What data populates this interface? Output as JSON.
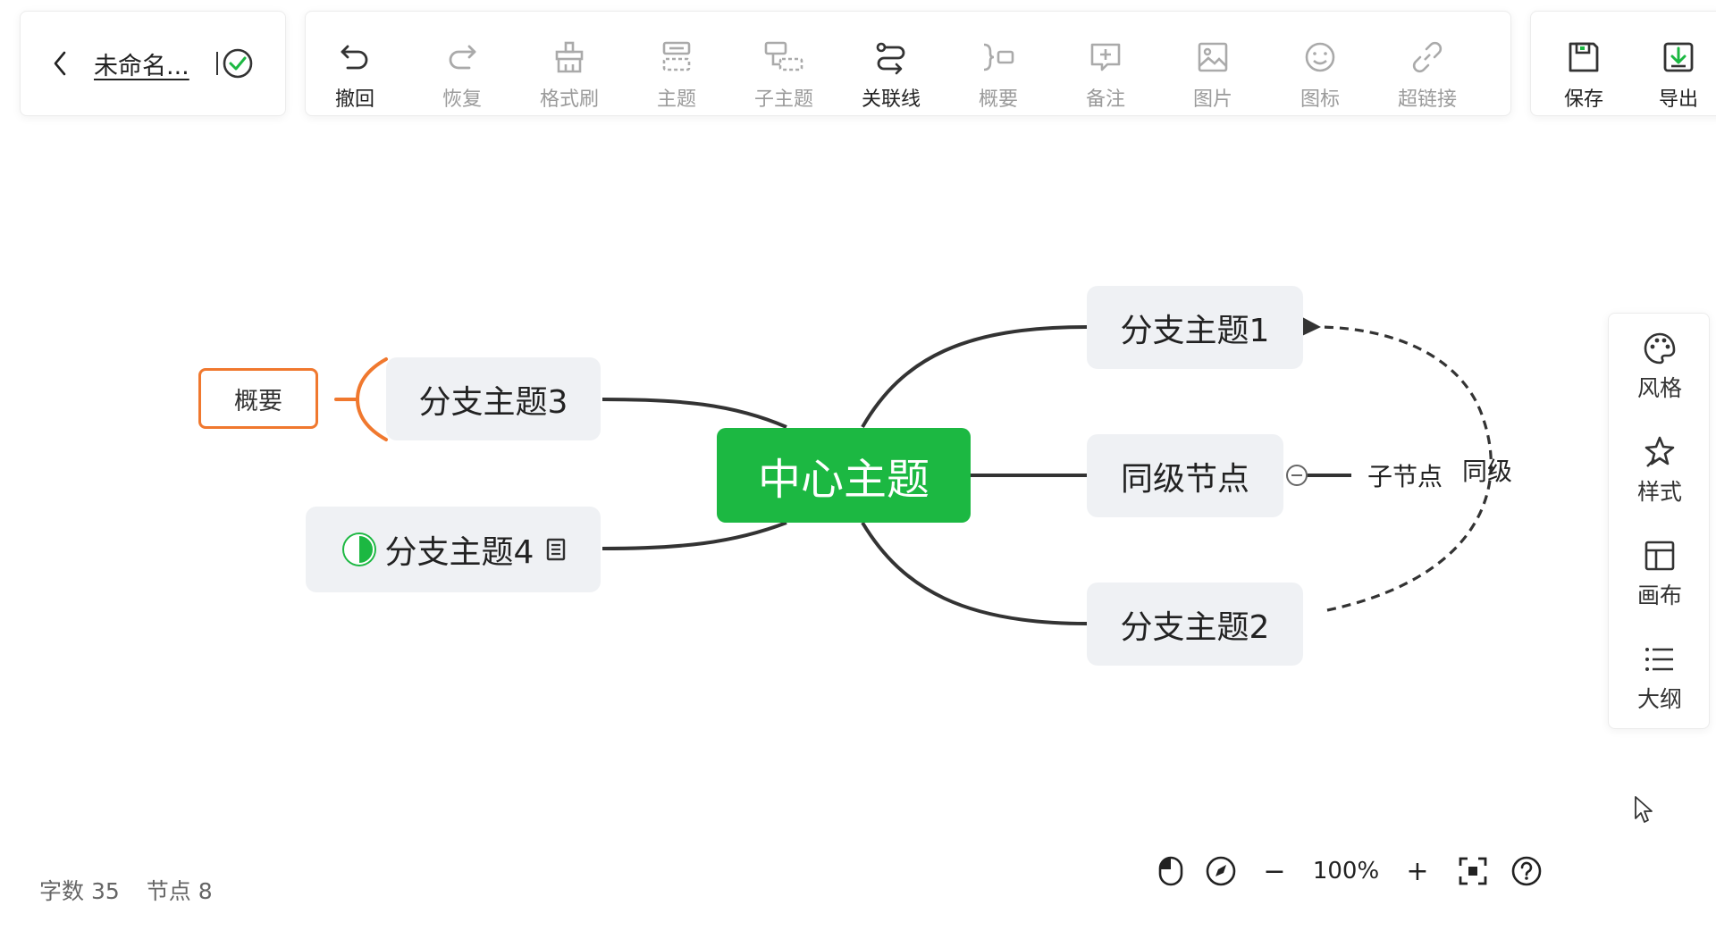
{
  "document": {
    "title": "未命名..."
  },
  "toolbar": {
    "tools": [
      {
        "label": "撤回",
        "icon": "undo-icon",
        "enabled": true
      },
      {
        "label": "恢复",
        "icon": "redo-icon",
        "enabled": false
      },
      {
        "label": "格式刷",
        "icon": "format-painter-icon",
        "enabled": false
      },
      {
        "label": "主题",
        "icon": "topic-icon",
        "enabled": false
      },
      {
        "label": "子主题",
        "icon": "subtopic-icon",
        "enabled": false
      },
      {
        "label": "关联线",
        "icon": "relation-line-icon",
        "enabled": true
      },
      {
        "label": "概要",
        "icon": "summary-icon",
        "enabled": false
      },
      {
        "label": "备注",
        "icon": "note-icon",
        "enabled": false
      },
      {
        "label": "图片",
        "icon": "image-icon",
        "enabled": false
      },
      {
        "label": "图标",
        "icon": "emoji-icon",
        "enabled": false
      },
      {
        "label": "超链接",
        "icon": "hyperlink-icon",
        "enabled": false
      }
    ],
    "save_label": "保存",
    "export_label": "导出"
  },
  "sidebar": {
    "items": [
      {
        "label": "风格",
        "icon": "palette-icon"
      },
      {
        "label": "样式",
        "icon": "style-icon"
      },
      {
        "label": "画布",
        "icon": "layout-icon"
      },
      {
        "label": "大纲",
        "icon": "outline-icon"
      }
    ]
  },
  "mindmap": {
    "center": "中心主题",
    "branch1": "分支主题1",
    "branch2": "分支主题2",
    "branch3": "分支主题3",
    "branch4": "分支主题4",
    "sibling": "同级节点",
    "child": "子节点",
    "relation_label": "同级",
    "summary": "概要"
  },
  "status": {
    "word_count_label": "字数",
    "word_count": "35",
    "node_count_label": "节点",
    "node_count": "8"
  },
  "zoom": {
    "level": "100%",
    "minus": "−",
    "plus": "+"
  },
  "colors": {
    "accent": "#1cb842",
    "summary": "#f0782e",
    "node_bg": "#eff1f4"
  }
}
